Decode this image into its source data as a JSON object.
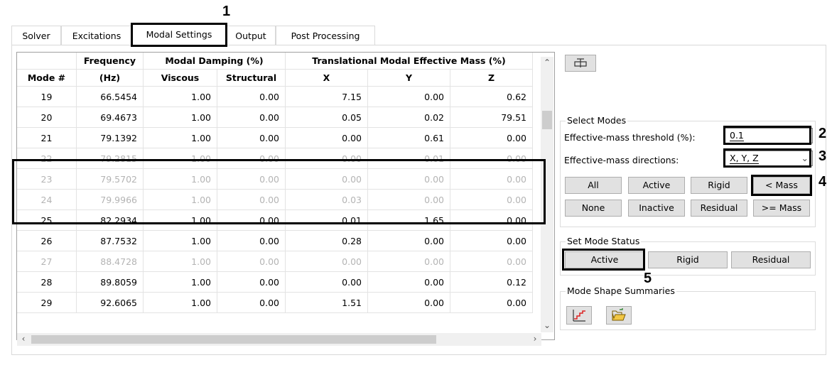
{
  "tabs": [
    {
      "label": "Solver"
    },
    {
      "label": "Excitations"
    },
    {
      "label": "Modal Settings"
    },
    {
      "label": "Output"
    },
    {
      "label": "Post Processing"
    }
  ],
  "table": {
    "group_headers": {
      "frequency": "Frequency",
      "modal_damping": "Modal Damping (%)",
      "effective_mass": "Translational Modal Effective Mass (%)"
    },
    "col_headers": {
      "mode": "Mode #",
      "hz": "(Hz)",
      "viscous": "Viscous",
      "structural": "Structural",
      "x": "X",
      "y": "Y",
      "z": "Z"
    },
    "rows": [
      {
        "mode": "19",
        "freq": "66.5454",
        "visc": "1.00",
        "struct": "0.00",
        "x": "7.15",
        "y": "0.00",
        "z": "0.62",
        "active": true
      },
      {
        "mode": "20",
        "freq": "69.4673",
        "visc": "1.00",
        "struct": "0.00",
        "x": "0.05",
        "y": "0.02",
        "z": "79.51",
        "active": true
      },
      {
        "mode": "21",
        "freq": "79.1392",
        "visc": "1.00",
        "struct": "0.00",
        "x": "0.00",
        "y": "0.61",
        "z": "0.00",
        "active": true
      },
      {
        "mode": "22",
        "freq": "79.2815",
        "visc": "1.00",
        "struct": "0.00",
        "x": "0.00",
        "y": "0.01",
        "z": "0.00",
        "active": false
      },
      {
        "mode": "23",
        "freq": "79.5702",
        "visc": "1.00",
        "struct": "0.00",
        "x": "0.00",
        "y": "0.00",
        "z": "0.00",
        "active": false
      },
      {
        "mode": "24",
        "freq": "79.9966",
        "visc": "1.00",
        "struct": "0.00",
        "x": "0.03",
        "y": "0.00",
        "z": "0.00",
        "active": false
      },
      {
        "mode": "25",
        "freq": "82.2934",
        "visc": "1.00",
        "struct": "0.00",
        "x": "0.01",
        "y": "1.65",
        "z": "0.00",
        "active": true
      },
      {
        "mode": "26",
        "freq": "87.7532",
        "visc": "1.00",
        "struct": "0.00",
        "x": "0.28",
        "y": "0.00",
        "z": "0.00",
        "active": true
      },
      {
        "mode": "27",
        "freq": "88.4728",
        "visc": "1.00",
        "struct": "0.00",
        "x": "0.00",
        "y": "0.00",
        "z": "0.00",
        "active": false
      },
      {
        "mode": "28",
        "freq": "89.8059",
        "visc": "1.00",
        "struct": "0.00",
        "x": "0.00",
        "y": "0.00",
        "z": "0.12",
        "active": true
      },
      {
        "mode": "29",
        "freq": "92.6065",
        "visc": "1.00",
        "struct": "0.00",
        "x": "1.51",
        "y": "0.00",
        "z": "0.00",
        "active": true
      }
    ]
  },
  "select_modes": {
    "title": "Select Modes",
    "threshold_label": "Effective-mass threshold (%):",
    "threshold_value": "0.1",
    "directions_label": "Effective-mass directions:",
    "directions_value": "X, Y, Z",
    "buttons_row1": [
      "All",
      "Active",
      "Rigid",
      "< Mass"
    ],
    "buttons_row2": [
      "None",
      "Inactive",
      "Residual",
      ">= Mass"
    ]
  },
  "set_mode_status": {
    "title": "Set Mode Status",
    "buttons": [
      "Active",
      "Rigid",
      "Residual"
    ]
  },
  "mode_shape_summaries": {
    "title": "Mode Shape Summaries"
  },
  "callouts": [
    "1",
    "2",
    "3",
    "4",
    "5"
  ],
  "icons": {
    "top_tool": "split-columns-icon",
    "summary_chart": "step-chart-icon",
    "summary_open": "open-folder-icon"
  }
}
